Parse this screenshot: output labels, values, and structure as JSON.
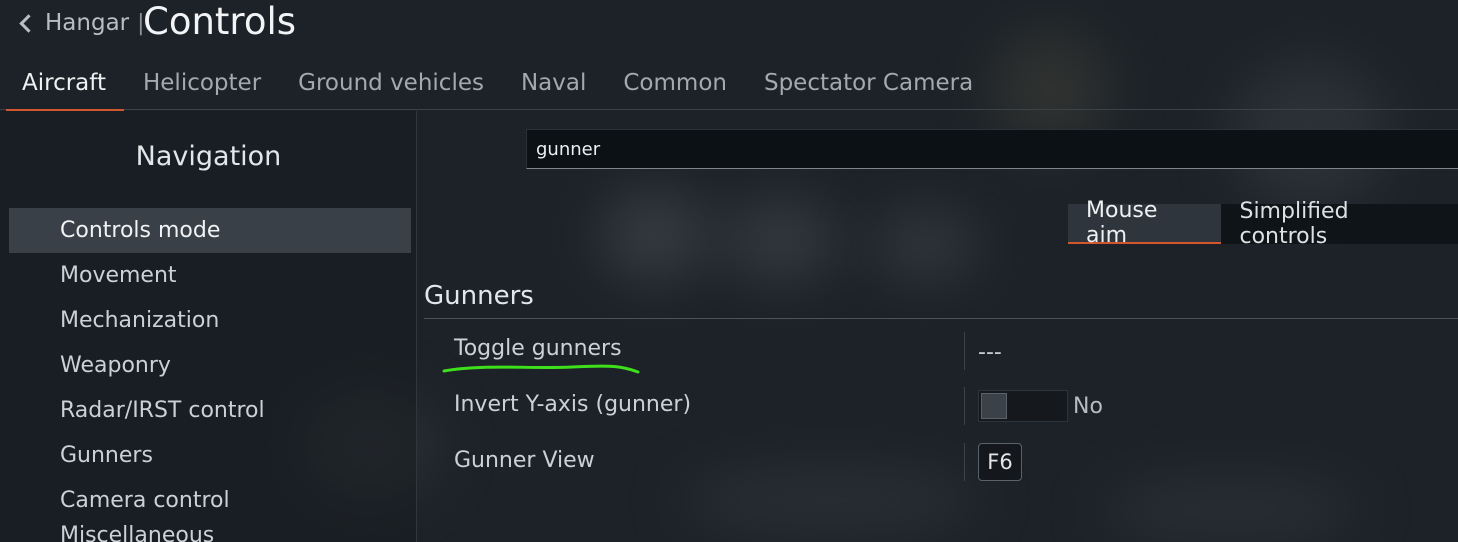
{
  "header": {
    "back_label": "Hangar",
    "separator": "|",
    "title": "Controls"
  },
  "tabs": [
    {
      "label": "Aircraft",
      "active": true
    },
    {
      "label": "Helicopter",
      "active": false
    },
    {
      "label": "Ground vehicles",
      "active": false
    },
    {
      "label": "Naval",
      "active": false
    },
    {
      "label": "Common",
      "active": false
    },
    {
      "label": "Spectator Camera",
      "active": false
    }
  ],
  "sidebar": {
    "title": "Navigation",
    "items": [
      {
        "label": "Controls mode",
        "selected": true
      },
      {
        "label": "Movement"
      },
      {
        "label": "Mechanization"
      },
      {
        "label": "Weaponry"
      },
      {
        "label": "Radar/IRST control"
      },
      {
        "label": "Gunners"
      },
      {
        "label": "Camera control"
      },
      {
        "label": "Miscellaneous"
      }
    ]
  },
  "search": {
    "value": "gunner",
    "placeholder": ""
  },
  "mode_switch": {
    "options": [
      {
        "label": "Mouse aim",
        "active": true
      },
      {
        "label": "Simplified controls",
        "active": false
      }
    ]
  },
  "section": {
    "title": "Gunners",
    "rows": [
      {
        "label": "Toggle gunners",
        "value": "---"
      },
      {
        "label": "Invert Y-axis (gunner)",
        "value": "No"
      },
      {
        "label": "Gunner View",
        "value": "F6"
      }
    ]
  },
  "colors": {
    "accent": "#d3572e",
    "annotation": "#3ee01c",
    "background": "#1d2228"
  },
  "icons": {
    "back": "chevron-left-icon"
  }
}
